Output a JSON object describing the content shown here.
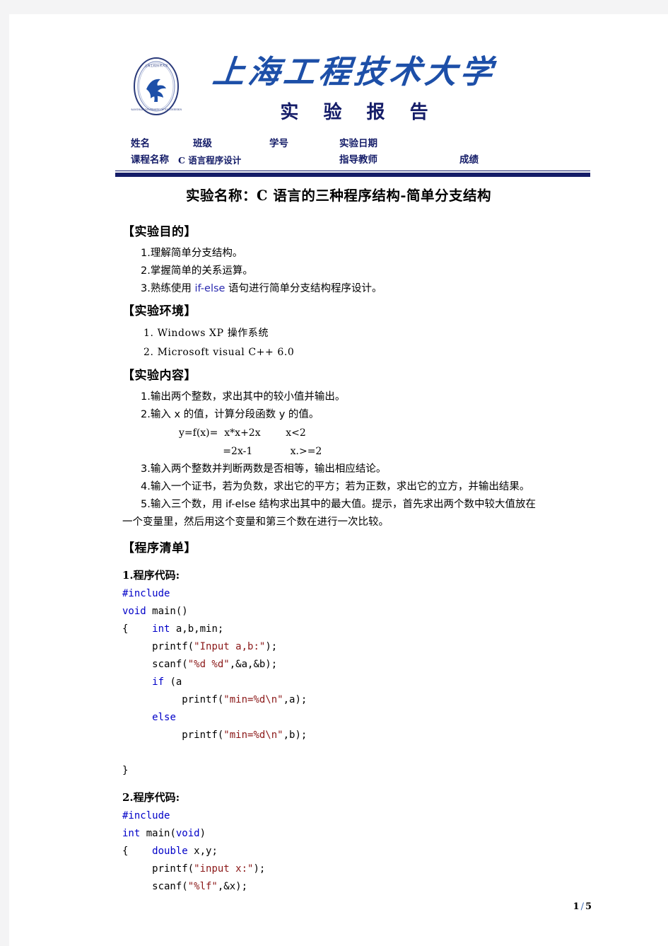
{
  "masthead": {
    "logo_icon": "university-seal-icon",
    "university_name": "上海工程技术大学",
    "report_title": "实 验 报 告"
  },
  "info_table": {
    "row1": [
      {
        "label": "姓名",
        "value": ""
      },
      {
        "label": "班级",
        "value": ""
      },
      {
        "label": "学号",
        "value": ""
      },
      {
        "label": "实验日期",
        "value": ""
      }
    ],
    "row2": [
      {
        "label": "课程名称",
        "value": "C 语言程序设计"
      },
      {
        "label": "指导教师",
        "value": ""
      },
      {
        "label": "成绩",
        "value": ""
      }
    ]
  },
  "doc_title": "实验名称：C 语言的三种程序结构-简单分支结构",
  "sections": {
    "purpose": {
      "heading": "【实验目的】",
      "items": [
        "1.理解简单分支结构。",
        "2.掌握简单的关系运算。",
        "3.熟练使用 if-else 语句进行简单分支结构程序设计。"
      ],
      "item3_pre": "3.熟练使用 ",
      "item3_kw": "if-else",
      "item3_post": " 语句进行简单分支结构程序设计。"
    },
    "environment": {
      "heading": "【实验环境】",
      "items": [
        "1.  Windows XP 操作系统",
        "2.  Microsoft visual C++  6.0"
      ]
    },
    "content": {
      "heading": "【实验内容】",
      "item1": "1.输出两个整数，求出其中的较小值并输出。",
      "item2": "2.输入 x 的值，计算分段函数 y 的值。",
      "formula_line1": "y=f(x)=  x*x+2x        x<2",
      "formula_line2": "              =2x-1            x.>=2",
      "item3": "3.输入两个整数并判断两数是否相等，输出相应结论。",
      "item4": "4.输入一个证书，若为负数，求出它的平方；若为正数，求出它的立方，并输出结果。",
      "item5_pre": "5.输入三个数，用 ",
      "item5_kw": "if-else",
      "item5_post": " 结构求出其中的最大值。提示，首先求出两个数中较大值放在",
      "item5_line2": "一个变量里，然后用这个变量和第三个数在进行一次比较。"
    },
    "listing": {
      "heading": "【程序清单】",
      "program1": {
        "label": "1.程序代码:",
        "lines": [
          {
            "parts": [
              {
                "t": "#include",
                "c": "kw"
              }
            ]
          },
          {
            "parts": [
              {
                "t": "void",
                "c": "kw"
              },
              {
                "t": " main()",
                "c": ""
              }
            ]
          },
          {
            "parts": [
              {
                "t": "{    ",
                "c": ""
              },
              {
                "t": "int",
                "c": "kw"
              },
              {
                "t": " a,b,min;",
                "c": ""
              }
            ]
          },
          {
            "parts": [
              {
                "t": "     printf(",
                "c": ""
              },
              {
                "t": "\"Input a,b:\"",
                "c": "str"
              },
              {
                "t": ");",
                "c": ""
              }
            ]
          },
          {
            "parts": [
              {
                "t": "     scanf(",
                "c": ""
              },
              {
                "t": "\"%d %d\"",
                "c": "str"
              },
              {
                "t": ",&a,&b);",
                "c": ""
              }
            ]
          },
          {
            "parts": [
              {
                "t": "     ",
                "c": ""
              },
              {
                "t": "if",
                "c": "kw"
              },
              {
                "t": " (a",
                "c": ""
              }
            ]
          },
          {
            "parts": [
              {
                "t": "          printf(",
                "c": ""
              },
              {
                "t": "\"min=%d\\n\"",
                "c": "str"
              },
              {
                "t": ",a);",
                "c": ""
              }
            ]
          },
          {
            "parts": [
              {
                "t": "     ",
                "c": ""
              },
              {
                "t": "else",
                "c": "kw"
              }
            ]
          },
          {
            "parts": [
              {
                "t": "          printf(",
                "c": ""
              },
              {
                "t": "\"min=%d\\n\"",
                "c": "str"
              },
              {
                "t": ",b);",
                "c": ""
              }
            ]
          },
          {
            "parts": [
              {
                "t": "",
                "c": ""
              }
            ]
          },
          {
            "parts": [
              {
                "t": "}",
                "c": ""
              }
            ]
          }
        ]
      },
      "program2": {
        "label": "2.程序代码:",
        "lines": [
          {
            "parts": [
              {
                "t": "#include",
                "c": "kw"
              }
            ]
          },
          {
            "parts": [
              {
                "t": "int",
                "c": "kw"
              },
              {
                "t": " main(",
                "c": ""
              },
              {
                "t": "void",
                "c": "kw"
              },
              {
                "t": ")",
                "c": ""
              }
            ]
          },
          {
            "parts": [
              {
                "t": "{    ",
                "c": ""
              },
              {
                "t": "double",
                "c": "kw"
              },
              {
                "t": " x,y;",
                "c": ""
              }
            ]
          },
          {
            "parts": [
              {
                "t": "     printf(",
                "c": ""
              },
              {
                "t": "\"input x:\"",
                "c": "str"
              },
              {
                "t": ");",
                "c": ""
              }
            ]
          },
          {
            "parts": [
              {
                "t": "     scanf(",
                "c": ""
              },
              {
                "t": "\"%lf\"",
                "c": "str"
              },
              {
                "t": ",&x);",
                "c": ""
              }
            ]
          }
        ]
      }
    }
  },
  "footer": {
    "page_current": "1",
    "separator": "/",
    "page_total": "5"
  },
  "colors": {
    "brand_blue": "#1d4fa8",
    "navy": "#141c68",
    "code_keyword": "#0000c8",
    "code_string": "#8b1818",
    "page_bg": "#f4f4f5"
  }
}
